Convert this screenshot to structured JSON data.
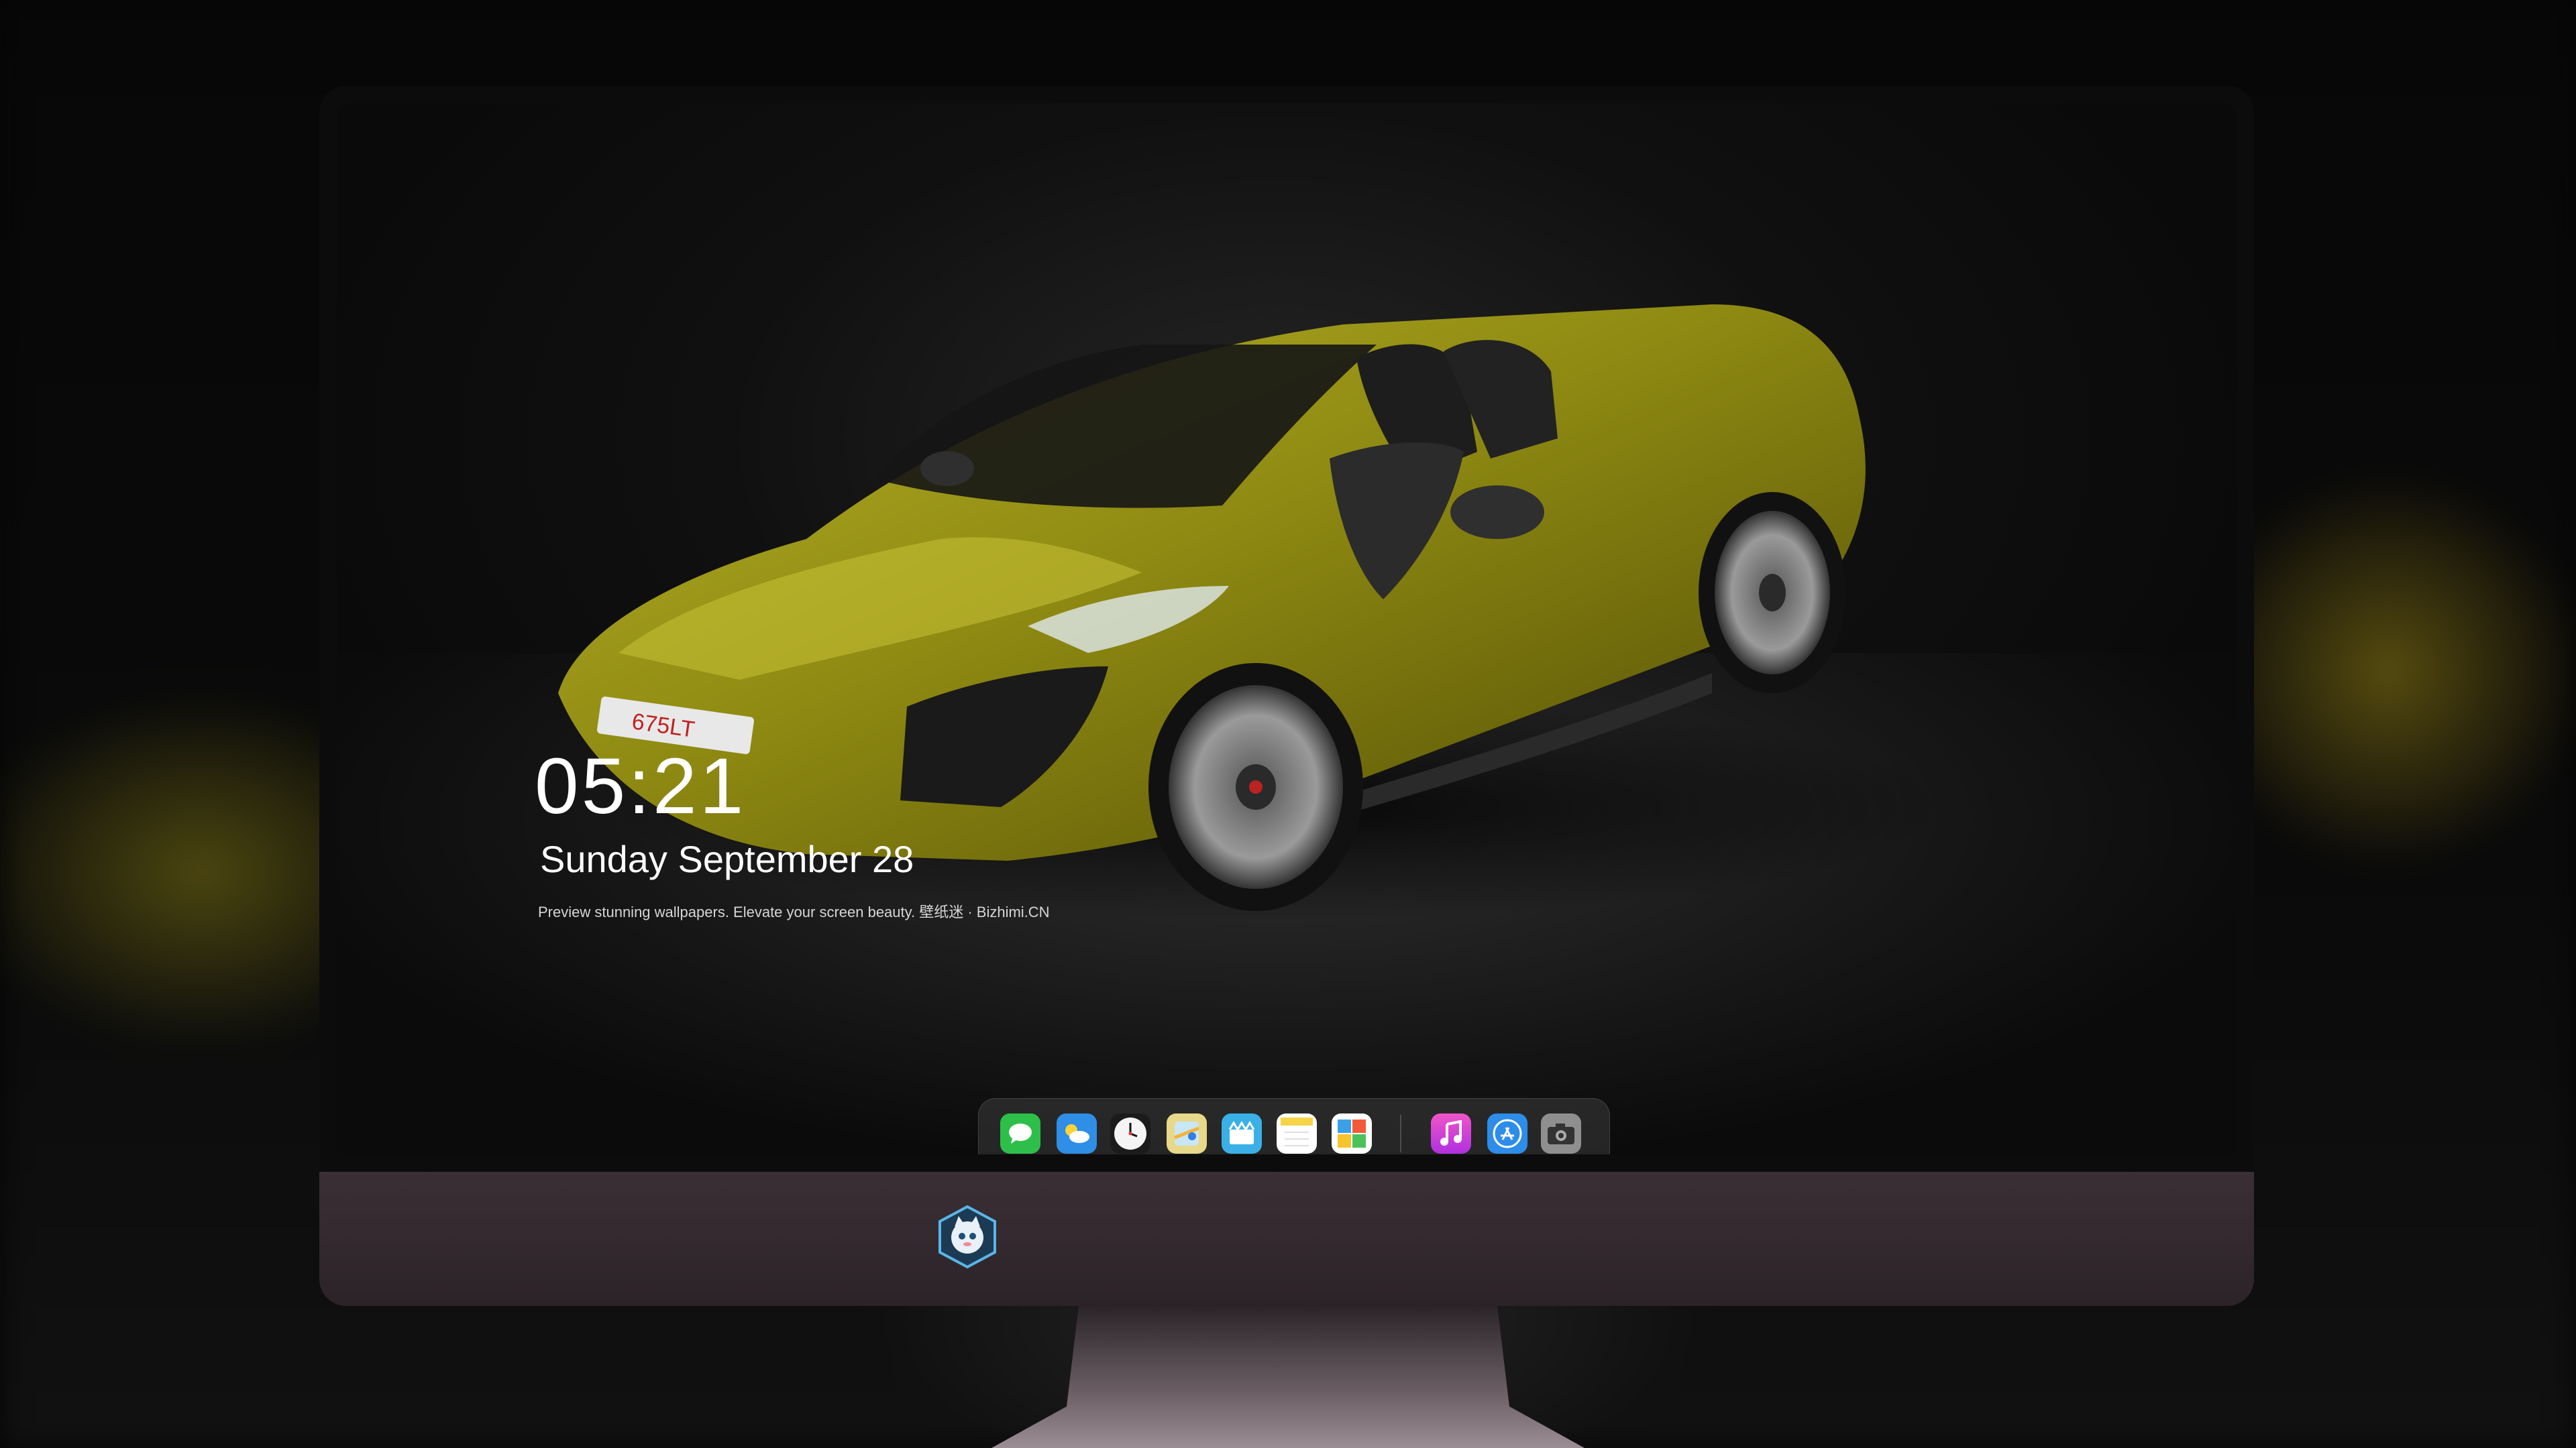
{
  "lockscreen": {
    "time": "05:21",
    "date": "Sunday September  28",
    "caption": "Preview stunning wallpapers. Elevate your screen beauty. 壁纸迷 · Bizhimi.CN"
  },
  "wallpaper": {
    "subject": "yellow convertible sports car",
    "plate_text": "675LT",
    "car_color": "#8a8a10"
  },
  "dock": {
    "apps": [
      {
        "icon": "messages-icon",
        "color": "#2dbf4a"
      },
      {
        "icon": "weather-icon",
        "color": "#2f8ee6"
      },
      {
        "icon": "clock-icon",
        "color": "#f2f2f2"
      },
      {
        "icon": "maps-icon",
        "color": "#e8d889"
      },
      {
        "icon": "clips-icon",
        "color": "#3bb0e6"
      },
      {
        "icon": "notes-icon",
        "color": "#f7e27a"
      },
      {
        "icon": "photos-grid-icon",
        "color": "#ffffff"
      },
      {
        "icon": "music-icon",
        "color": "#d23fd8"
      },
      {
        "icon": "app-store-icon",
        "color": "#2e8de8"
      },
      {
        "icon": "camera-icon",
        "color": "#9a9a9a"
      }
    ]
  },
  "monitor": {
    "bezel_color": "#0c0c0c",
    "chin_color": "#372d33",
    "logo": "cat-astronaut-logo-icon"
  }
}
